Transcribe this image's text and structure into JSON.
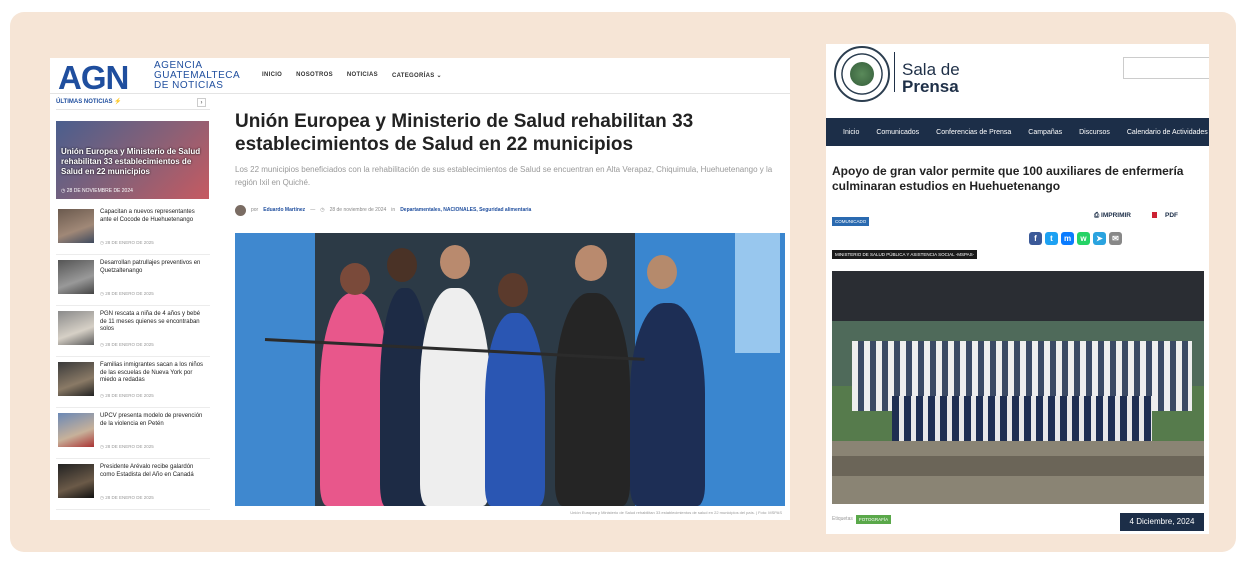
{
  "agn": {
    "logo": "AGN",
    "logo_line1": "AGENCIA",
    "logo_line2": "GUATEMALTECA",
    "logo_line3": "DE NOTICIAS",
    "nav": [
      "INICIO",
      "NOSOTROS",
      "NOTICIAS",
      "CATEGORÍAS"
    ],
    "latest_label": "ÚLTIMAS NOTICIAS",
    "feature": {
      "title": "Unión Europea y Ministerio de Salud rehabilitan 33 establecimientos de Salud en 22 municipios",
      "date": "28 DE NOVIEMBRE DE 2024"
    },
    "side_items": [
      {
        "title": "Capacitan a nuevos representantes ante el Cocode de Huehuetenango",
        "date": "28 DE ENERO DE 2025"
      },
      {
        "title": "Desarrollan patrullajes preventivos en Quetzaltenango",
        "date": "28 DE ENERO DE 2025"
      },
      {
        "title": "PGN rescata a niña de 4 años y bebé de 11 meses quienes se encontraban solos",
        "date": "28 DE ENERO DE 2025"
      },
      {
        "title": "Familias inmigrantes sacan a los niños de las escuelas de Nueva York por miedo a redadas",
        "date": "28 DE ENERO DE 2025"
      },
      {
        "title": "UPCV presenta modelo de prevención de la violencia en Petén",
        "date": "28 DE ENERO DE 2025"
      },
      {
        "title": "Presidente Arévalo recibe galardón como Estadista del Año en Canadá",
        "date": "28 DE ENERO DE 2025"
      }
    ],
    "article": {
      "title": "Unión Europea y Ministerio de Salud rehabilitan 33 establecimientos de Salud en 22 municipios",
      "subtitle": "Los 22 municipios beneficiados con la rehabilitación de sus establecimientos de Salud se encuentran en Alta Verapaz, Chiquimula, Huehuetenango y la región Ixil en Quiché.",
      "author_prefix": "por",
      "author": "Eduardo Martínez",
      "date": "28 de noviembre de 2024",
      "categories": "Departamentales, NACIONALES, Seguridad alimentaria",
      "photo_caption": "Unión Europea y Ministerio de Salud rehabilitan 33 establecimientos de salud en 22 municipios del país. | Foto: MSPAS"
    }
  },
  "sala": {
    "name_line1": "Sala de",
    "name_line2": "Prensa",
    "nav": [
      "Inicio",
      "Comunicados",
      "Conferencias de Prensa",
      "Campañas",
      "Discursos",
      "Calendario de Actividades"
    ],
    "title": "Apoyo de gran valor permite que 100 auxiliares de enfermería culminaran estudios en Huehuetenango",
    "badge": "COMUNICADO",
    "print_label": "IMPRIMIR",
    "pdf_label": "PDF",
    "share_icons": [
      "facebook-icon",
      "twitter-icon",
      "messenger-icon",
      "whatsapp-icon",
      "telegram-icon",
      "email-icon"
    ],
    "ministry_tag": "MINISTERIO DE SALUD PÚBLICA Y ASISTENCIA SOCIAL -MSPAS-",
    "bottom_label": "Etiquetas",
    "tag": "FOTOGRAFÍA",
    "date": "4 Diciembre, 2024"
  },
  "colors": {
    "agn_blue": "#1f4e9e",
    "sala_navy": "#1c2e48",
    "frame_bg": "#f6e5d6"
  }
}
